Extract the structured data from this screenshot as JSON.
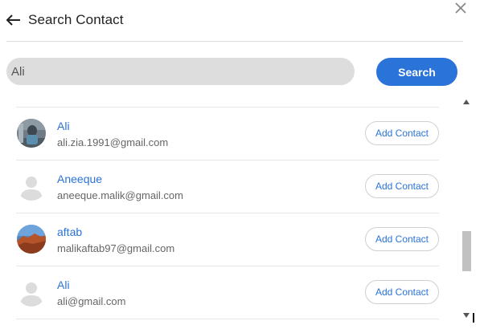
{
  "header": {
    "title": "Search Contact",
    "back_icon": "arrow-left-icon",
    "close_icon": "close-icon"
  },
  "search": {
    "value": "Ali",
    "button_label": "Search"
  },
  "contacts": [
    {
      "name": "Ali",
      "email": "ali.zia.1991@gmail.com",
      "avatar": "photo-portrait",
      "action_label": "Add Contact"
    },
    {
      "name": "Aneeque",
      "email": "aneeque.malik@gmail.com",
      "avatar": "default-person",
      "action_label": "Add Contact"
    },
    {
      "name": "aftab",
      "email": "malikaftab97@gmail.com",
      "avatar": "photo-landscape",
      "action_label": "Add Contact"
    },
    {
      "name": "Ali",
      "email": "ali@gmail.com",
      "avatar": "default-person",
      "action_label": "Add Contact"
    }
  ],
  "colors": {
    "accent": "#2a73d9",
    "input_bg": "#dddddd",
    "divider": "#e6e6e6"
  }
}
